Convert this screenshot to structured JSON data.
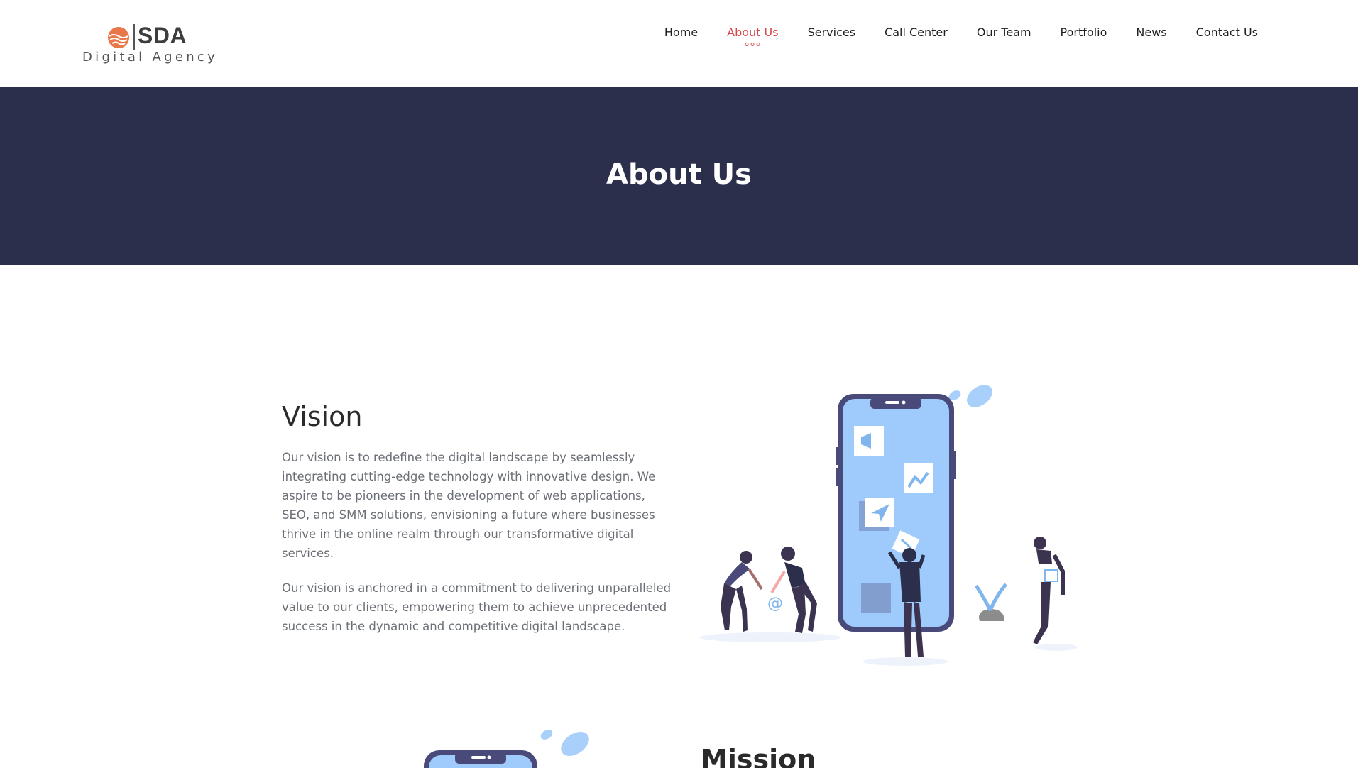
{
  "logo": {
    "title": "SDA",
    "subtitle": "Digital Agency",
    "mark_color": "#e8774a"
  },
  "nav": {
    "items": [
      {
        "label": "Home",
        "active": false
      },
      {
        "label": "About Us",
        "active": true
      },
      {
        "label": "Services",
        "active": false
      },
      {
        "label": "Call Center",
        "active": false
      },
      {
        "label": "Our Team",
        "active": false
      },
      {
        "label": "Portfolio",
        "active": false
      },
      {
        "label": "News",
        "active": false
      },
      {
        "label": "Contact Us",
        "active": false
      }
    ],
    "active_color": "#d5474a"
  },
  "banner": {
    "title": "About Us",
    "background": "#2b2f4c"
  },
  "vision": {
    "heading": "Vision",
    "paragraphs": [
      "Our vision is to redefine the digital landscape by seamlessly integrating cutting-edge technology with innovative design. We aspire to be pioneers in the development of web applications, SEO, and SMM solutions, envisioning a future where businesses thrive in the online realm through our transformative digital services.",
      "Our vision is anchored in a commitment to delivering unparalleled value to our clients, empowering them to achieve unprecedented success in the dynamic and competitive digital landscape."
    ]
  },
  "mission": {
    "heading": "Mission"
  },
  "illustration": {
    "phone_frame_color": "#4a4a7a",
    "phone_screen_color": "#9ecbfb",
    "accent_color": "#7fb6ee"
  }
}
